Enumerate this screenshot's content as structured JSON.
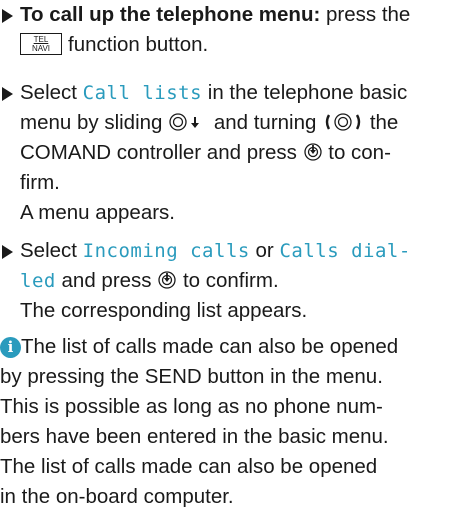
{
  "step1": {
    "bold": "To call up the telephone menu:",
    "text_a": " press the",
    "key_top": "TEL",
    "key_bottom": "NAVI",
    "text_b": "function button."
  },
  "step2": {
    "a": "Select ",
    "mono": "Call lists",
    "b": " in the telephone basic",
    "c": "menu by sliding ",
    "d": " and turning ",
    "e": " the",
    "f": "COMAND controller and press ",
    "g": " to con-",
    "h": "firm.",
    "result": "A menu appears."
  },
  "step3": {
    "a": "Select ",
    "mono1": "Incoming calls",
    "b": " or ",
    "mono2a": "Calls dial-",
    "mono2b": "led",
    "c": " and press ",
    "d": " to confirm.",
    "result": "The corresponding list appears."
  },
  "note": {
    "icon_letter": "i",
    "line1": " The list of calls made can also be opened",
    "line2": "by pressing the SEND button in the menu.",
    "line3": "This is possible as long as no phone num-",
    "line4": "bers have been entered in the basic menu.",
    "line5": "The list of calls made can also be opened",
    "line6": "in the on-board computer."
  },
  "colors": {
    "accent": "#2a9bbd",
    "text": "#1a1a1a"
  },
  "icons": {
    "slide": "controller-slide-down-icon",
    "turn": "controller-turn-icon",
    "press": "controller-press-icon",
    "bullet": "triangle-bullet-icon",
    "info": "info-icon"
  }
}
